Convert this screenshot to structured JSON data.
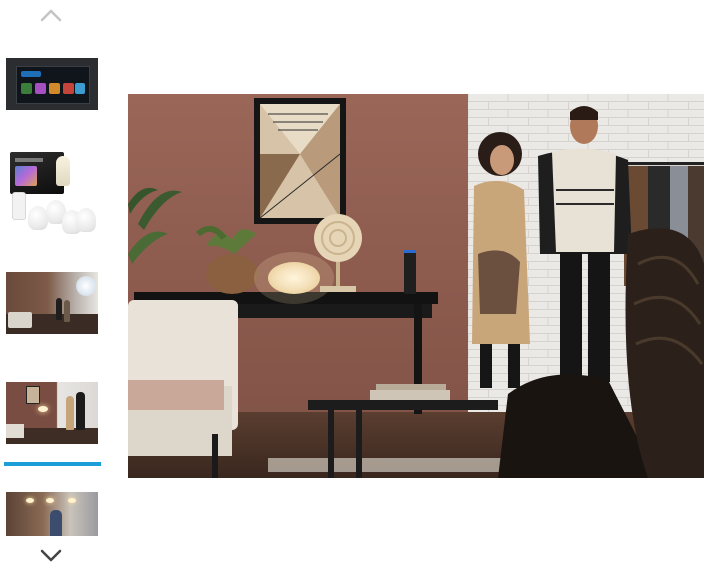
{
  "gallery": {
    "scroll_up_icon": "chevron-up-icon",
    "scroll_down_icon": "chevron-down-icon",
    "selected_index": 3,
    "accent_color": "#1a9fd8",
    "thumbnails": [
      {
        "subject": "app-screenshot"
      },
      {
        "subject": "starter-kit-package"
      },
      {
        "subject": "living-room-scene"
      },
      {
        "subject": "couple-in-living-room"
      },
      {
        "subject": "room-with-ceiling-lights"
      }
    ]
  },
  "main_image": {
    "subject": "couple-in-living-room",
    "colors": {
      "wall": "#8a5a4e",
      "brick": "#e9e7e4",
      "floor": "#4a3328"
    }
  }
}
